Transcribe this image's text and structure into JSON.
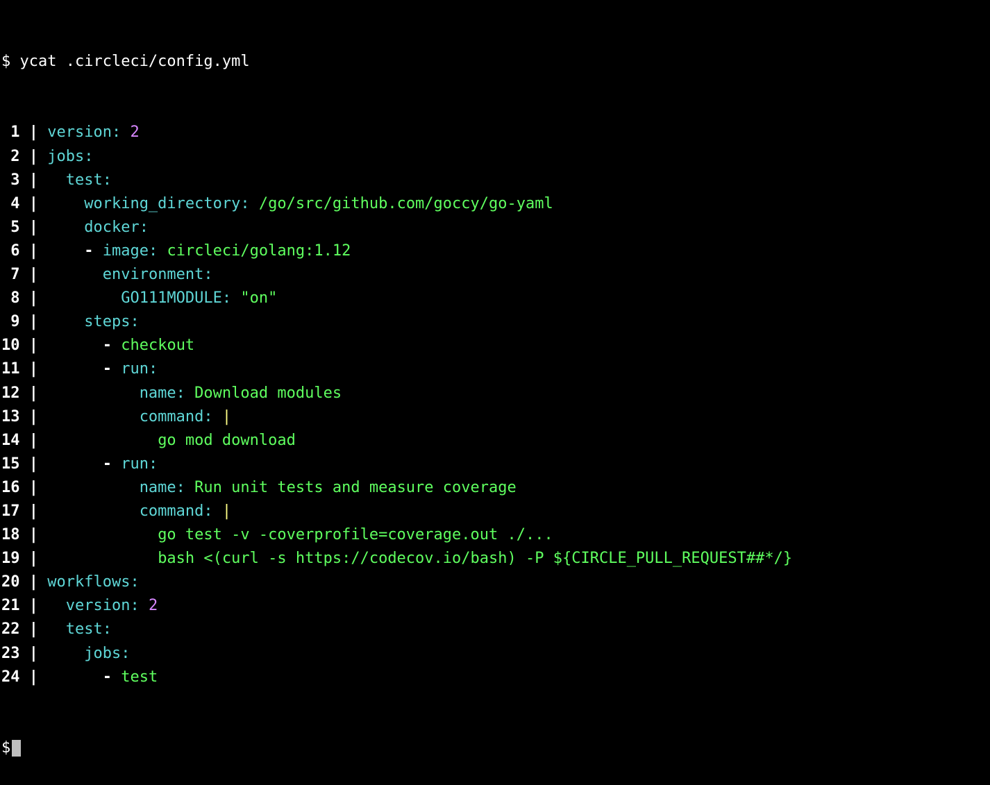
{
  "prompt": "$",
  "command": "ycat .circleci/config.yml",
  "gutter_sep": " | ",
  "colors": {
    "prompt": "#ffffff",
    "key": "#5fd7d7",
    "value_green": "#5fff5f",
    "string_magenta": "#d787ff",
    "literal_pipe": "#ffff87",
    "dash": "#ffffff"
  },
  "lines": [
    {
      "num": "1",
      "tokens": [
        {
          "class": "key",
          "text": "version"
        },
        {
          "class": "key",
          "text": ": "
        },
        {
          "class": "str",
          "text": "2"
        }
      ]
    },
    {
      "num": "2",
      "tokens": [
        {
          "class": "key",
          "text": "jobs"
        },
        {
          "class": "key",
          "text": ":"
        }
      ]
    },
    {
      "num": "3",
      "tokens": [
        {
          "class": null,
          "text": "  "
        },
        {
          "class": "key",
          "text": "test"
        },
        {
          "class": "key",
          "text": ":"
        }
      ]
    },
    {
      "num": "4",
      "tokens": [
        {
          "class": null,
          "text": "    "
        },
        {
          "class": "key",
          "text": "working_directory"
        },
        {
          "class": "key",
          "text": ": "
        },
        {
          "class": "val",
          "text": "/go/src/github.com/goccy/go-yaml"
        }
      ]
    },
    {
      "num": "5",
      "tokens": [
        {
          "class": null,
          "text": "    "
        },
        {
          "class": "key",
          "text": "docker"
        },
        {
          "class": "key",
          "text": ":"
        }
      ]
    },
    {
      "num": "6",
      "tokens": [
        {
          "class": null,
          "text": "    "
        },
        {
          "class": "dash",
          "text": "- "
        },
        {
          "class": "key",
          "text": "image"
        },
        {
          "class": "key",
          "text": ": "
        },
        {
          "class": "val",
          "text": "circleci/golang:1.12"
        }
      ]
    },
    {
      "num": "7",
      "tokens": [
        {
          "class": null,
          "text": "      "
        },
        {
          "class": "key",
          "text": "environment"
        },
        {
          "class": "key",
          "text": ":"
        }
      ]
    },
    {
      "num": "8",
      "tokens": [
        {
          "class": null,
          "text": "        "
        },
        {
          "class": "key",
          "text": "GO111MODULE"
        },
        {
          "class": "key",
          "text": ": "
        },
        {
          "class": "val",
          "text": "\"on\""
        }
      ]
    },
    {
      "num": "9",
      "tokens": [
        {
          "class": null,
          "text": "    "
        },
        {
          "class": "key",
          "text": "steps"
        },
        {
          "class": "key",
          "text": ":"
        }
      ]
    },
    {
      "num": "10",
      "tokens": [
        {
          "class": null,
          "text": "      "
        },
        {
          "class": "dash",
          "text": "- "
        },
        {
          "class": "val",
          "text": "checkout"
        }
      ]
    },
    {
      "num": "11",
      "tokens": [
        {
          "class": null,
          "text": "      "
        },
        {
          "class": "dash",
          "text": "- "
        },
        {
          "class": "key",
          "text": "run"
        },
        {
          "class": "key",
          "text": ":"
        }
      ]
    },
    {
      "num": "12",
      "tokens": [
        {
          "class": null,
          "text": "          "
        },
        {
          "class": "key",
          "text": "name"
        },
        {
          "class": "key",
          "text": ": "
        },
        {
          "class": "val",
          "text": "Download modules"
        }
      ]
    },
    {
      "num": "13",
      "tokens": [
        {
          "class": null,
          "text": "          "
        },
        {
          "class": "key",
          "text": "command"
        },
        {
          "class": "key",
          "text": ": "
        },
        {
          "class": "pipe",
          "text": "|"
        }
      ]
    },
    {
      "num": "14",
      "tokens": [
        {
          "class": null,
          "text": "            "
        },
        {
          "class": "val",
          "text": "go mod download"
        }
      ]
    },
    {
      "num": "15",
      "tokens": [
        {
          "class": null,
          "text": "      "
        },
        {
          "class": "dash",
          "text": "- "
        },
        {
          "class": "key",
          "text": "run"
        },
        {
          "class": "key",
          "text": ":"
        }
      ]
    },
    {
      "num": "16",
      "tokens": [
        {
          "class": null,
          "text": "          "
        },
        {
          "class": "key",
          "text": "name"
        },
        {
          "class": "key",
          "text": ": "
        },
        {
          "class": "val",
          "text": "Run unit tests and measure coverage"
        }
      ]
    },
    {
      "num": "17",
      "tokens": [
        {
          "class": null,
          "text": "          "
        },
        {
          "class": "key",
          "text": "command"
        },
        {
          "class": "key",
          "text": ": "
        },
        {
          "class": "pipe",
          "text": "|"
        }
      ]
    },
    {
      "num": "18",
      "tokens": [
        {
          "class": null,
          "text": "            "
        },
        {
          "class": "val",
          "text": "go test -v -coverprofile=coverage.out ./..."
        }
      ]
    },
    {
      "num": "19",
      "tokens": [
        {
          "class": null,
          "text": "            "
        },
        {
          "class": "val",
          "text": "bash <(curl -s https://codecov.io/bash) -P ${CIRCLE_PULL_REQUEST##*/}"
        }
      ]
    },
    {
      "num": "20",
      "tokens": [
        {
          "class": "key",
          "text": "workflows"
        },
        {
          "class": "key",
          "text": ":"
        }
      ]
    },
    {
      "num": "21",
      "tokens": [
        {
          "class": null,
          "text": "  "
        },
        {
          "class": "key",
          "text": "version"
        },
        {
          "class": "key",
          "text": ": "
        },
        {
          "class": "str",
          "text": "2"
        }
      ]
    },
    {
      "num": "22",
      "tokens": [
        {
          "class": null,
          "text": "  "
        },
        {
          "class": "key",
          "text": "test"
        },
        {
          "class": "key",
          "text": ":"
        }
      ]
    },
    {
      "num": "23",
      "tokens": [
        {
          "class": null,
          "text": "    "
        },
        {
          "class": "key",
          "text": "jobs"
        },
        {
          "class": "key",
          "text": ":"
        }
      ]
    },
    {
      "num": "24",
      "tokens": [
        {
          "class": null,
          "text": "      "
        },
        {
          "class": "dash",
          "text": "- "
        },
        {
          "class": "val",
          "text": "test"
        }
      ]
    }
  ]
}
